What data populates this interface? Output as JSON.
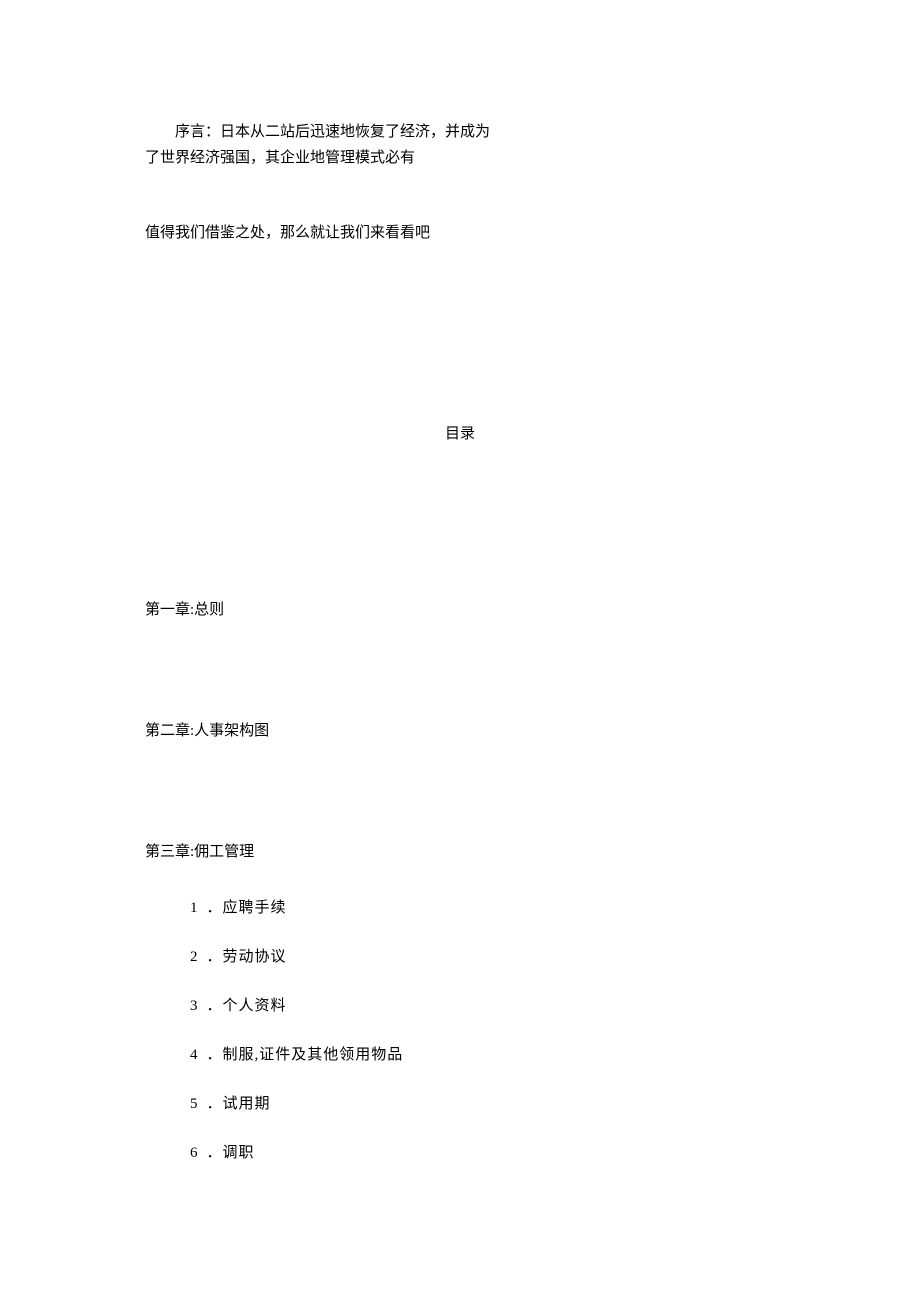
{
  "preface": {
    "line1": "序言：日本从二站后迅速地恢复了经济，并成为",
    "line2": "了世界经济强国，其企业地管理模式必有",
    "line3": "值得我们借鉴之处，那么就让我们来看看吧"
  },
  "toc_title": "目录",
  "chapters": [
    {
      "title": "第一章:总则",
      "items": []
    },
    {
      "title": "第二章:人事架构图",
      "items": []
    },
    {
      "title": "第三章:佣工管理",
      "items": [
        {
          "num": "1",
          "text": "．应聘手续"
        },
        {
          "num": "2",
          "text": "．劳动协议"
        },
        {
          "num": "3",
          "text": "．个人资料"
        },
        {
          "num": "4",
          "text": "．制服,证件及其他领用物品"
        },
        {
          "num": "5",
          "text": "．试用期"
        },
        {
          "num": "6",
          "text": "．调职"
        }
      ]
    }
  ]
}
